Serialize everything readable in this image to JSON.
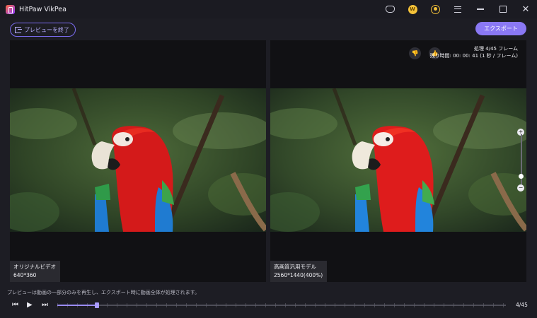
{
  "window": {
    "title": "HitPaw VikPea",
    "coin_label": "W"
  },
  "toolbar": {
    "exit_preview_label": "プレビューを終了",
    "export_label": "エクスポート"
  },
  "preview": {
    "left": {
      "label": "オリジナルビデオ",
      "resolution": "640*360"
    },
    "right": {
      "label": "高画質汎用モデル",
      "resolution": "2560*1440(400%)",
      "processing_status": "処理 4/45 フレーム",
      "remaining_time": "残り時間: 00: 00: 41 (1 秒 / フレーム)",
      "zoom_level": 0.2
    }
  },
  "notice": "プレビューは動画の一部分のみを再生し、エクスポート時に動画全体が処理されます。",
  "player": {
    "frame_counter": "4/45",
    "current_frame": 4,
    "total_frames": 45
  },
  "icons": {
    "prev": "step-back-icon",
    "play": "play-icon",
    "next": "step-forward-icon",
    "dislike": "thumbs-down-icon",
    "like": "thumbs-up-icon"
  },
  "colors": {
    "accent": "#8a78f4",
    "background": "#1d1d24",
    "pane": "#111114"
  }
}
